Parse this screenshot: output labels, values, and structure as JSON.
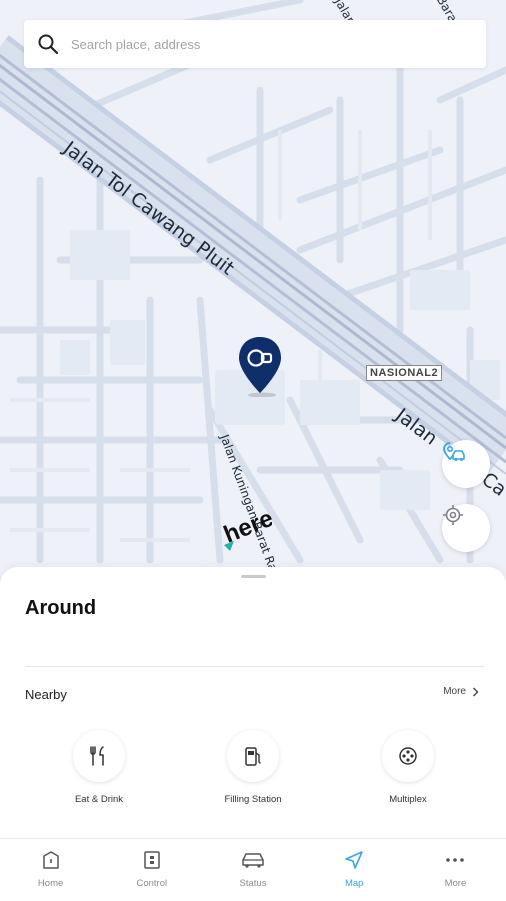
{
  "search": {
    "placeholder": "Search place, address"
  },
  "map": {
    "road_labels": {
      "toll": "Jalan Tol Cawang Pluit",
      "toll_east": "Jalan",
      "toll_east_tail": "Ca",
      "kuningan": "Jalan Kuningan Barat Ra",
      "top_a": "Jalan P",
      "top_b": "Barat"
    },
    "badge": "NASIONAL2",
    "logo_text": "here",
    "pin_color": "#0f2f6b",
    "accent_color": "#3aa8d8"
  },
  "sheet": {
    "title": "Around",
    "nearby_label": "Nearby",
    "more_label": "More",
    "categories": [
      {
        "label": "Eat & Drink",
        "icon": "fork-knife-icon"
      },
      {
        "label": "Filling Station",
        "icon": "fuel-pump-icon"
      },
      {
        "label": "Multiplex",
        "icon": "film-reel-icon"
      }
    ]
  },
  "tabs": [
    {
      "label": "Home",
      "icon": "home-icon"
    },
    {
      "label": "Control",
      "icon": "remote-control-icon"
    },
    {
      "label": "Status",
      "icon": "car-icon"
    },
    {
      "label": "Map",
      "icon": "navigation-arrow-icon",
      "active": true
    },
    {
      "label": "More",
      "icon": "more-dots-icon"
    }
  ]
}
